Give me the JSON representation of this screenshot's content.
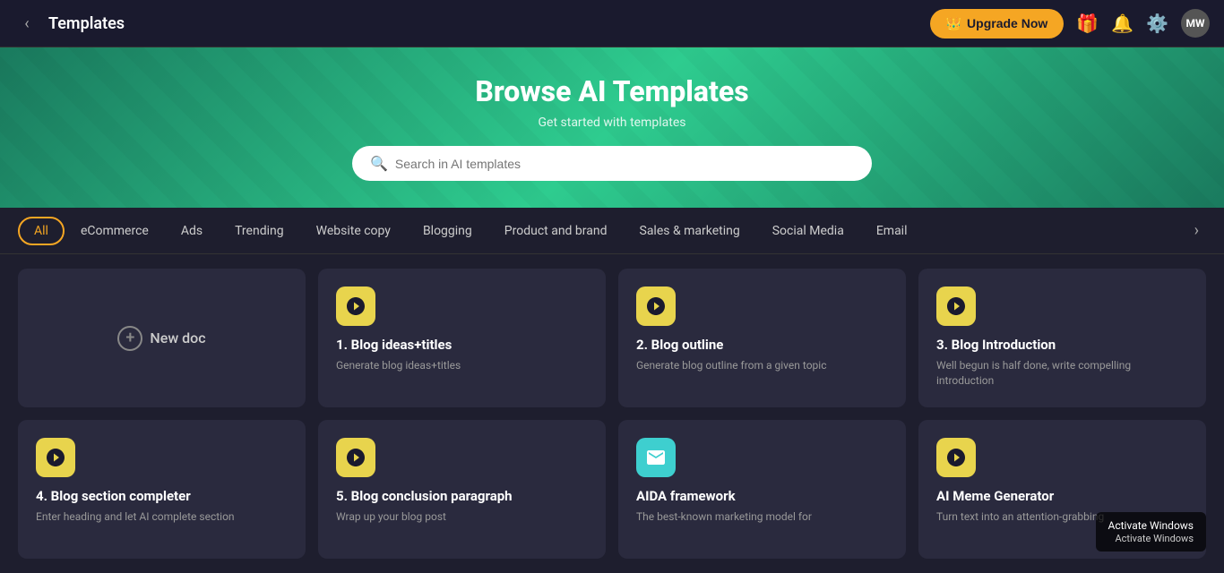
{
  "header": {
    "title": "Templates",
    "upgrade_label": "Upgrade Now",
    "avatar_initials": "MW"
  },
  "hero": {
    "title": "Browse AI Templates",
    "subtitle": "Get started with templates",
    "search_placeholder": "Search in AI templates"
  },
  "tabs": [
    {
      "id": "all",
      "label": "All",
      "active": true
    },
    {
      "id": "ecommerce",
      "label": "eCommerce",
      "active": false
    },
    {
      "id": "ads",
      "label": "Ads",
      "active": false
    },
    {
      "id": "trending",
      "label": "Trending",
      "active": false
    },
    {
      "id": "website-copy",
      "label": "Website copy",
      "active": false
    },
    {
      "id": "blogging",
      "label": "Blogging",
      "active": false
    },
    {
      "id": "product-brand",
      "label": "Product and brand",
      "active": false
    },
    {
      "id": "sales-marketing",
      "label": "Sales & marketing",
      "active": false
    },
    {
      "id": "social-media",
      "label": "Social Media",
      "active": false
    },
    {
      "id": "email",
      "label": "Email",
      "active": false
    }
  ],
  "new_doc_label": "New doc",
  "templates": [
    {
      "id": 1,
      "number": "1.",
      "title": "Blog ideas+titles",
      "description": "Generate blog ideas+titles",
      "icon_type": "b-yellow",
      "icon_color": "yellow"
    },
    {
      "id": 2,
      "number": "2.",
      "title": "Blog outline",
      "description": "Generate blog outline from a given topic",
      "icon_type": "b-yellow",
      "icon_color": "yellow"
    },
    {
      "id": 3,
      "number": "3.",
      "title": "Blog Introduction",
      "description": "Well begun is half done, write compelling introduction",
      "icon_type": "b-yellow",
      "icon_color": "yellow"
    },
    {
      "id": 4,
      "number": "4.",
      "title": "Blog section completer",
      "description": "Enter heading and let AI complete section",
      "icon_type": "b-yellow",
      "icon_color": "yellow"
    },
    {
      "id": 5,
      "number": "5.",
      "title": "Blog conclusion paragraph",
      "description": "Wrap up your blog post",
      "icon_type": "b-yellow",
      "icon_color": "yellow"
    },
    {
      "id": 6,
      "number": "",
      "title": "AIDA framework",
      "description": "The best-known marketing model for",
      "icon_type": "email-cyan",
      "icon_color": "cyan"
    },
    {
      "id": 7,
      "number": "",
      "title": "AI Meme Generator",
      "description": "Turn text into an attention-grabbing",
      "icon_type": "b-yellow",
      "icon_color": "yellow"
    }
  ]
}
